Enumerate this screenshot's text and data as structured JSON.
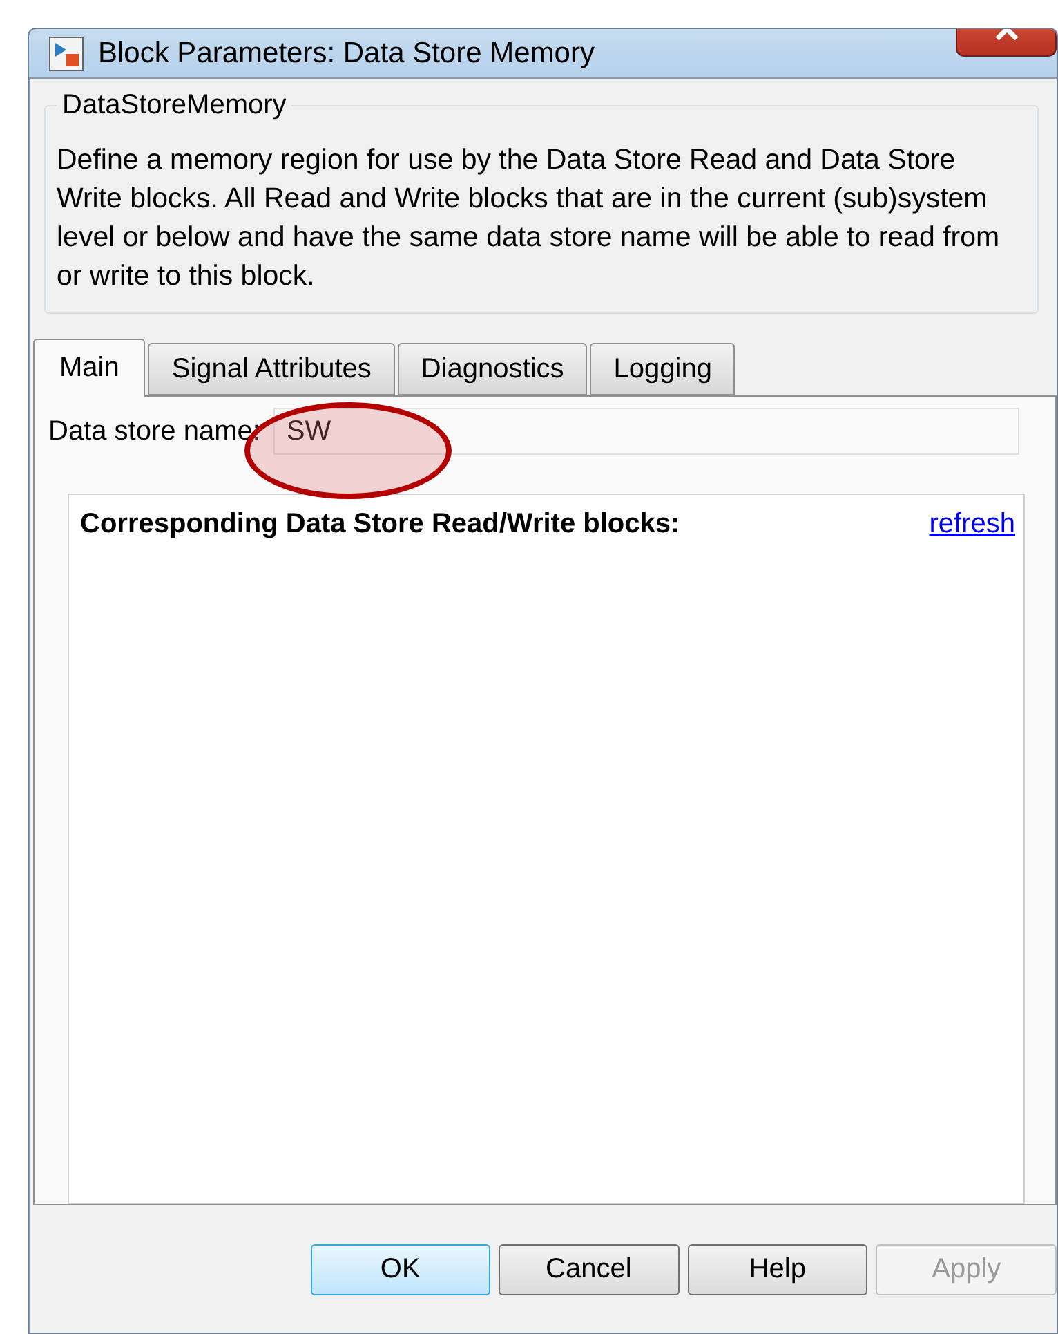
{
  "window": {
    "title": "Block Parameters: Data Store Memory"
  },
  "group": {
    "title": "DataStoreMemory",
    "description": "Define a memory region for use by the Data Store Read and Data Store Write blocks. All Read and Write blocks that are in the current (sub)system level or below and have the same data store name will be able to read from or write to this block."
  },
  "tabs": [
    {
      "label": "Main",
      "selected": true
    },
    {
      "label": "Signal Attributes",
      "selected": false
    },
    {
      "label": "Diagnostics",
      "selected": false
    },
    {
      "label": "Logging",
      "selected": false
    }
  ],
  "field": {
    "label": "Data store name:",
    "value": "SW"
  },
  "panel": {
    "heading": "Corresponding Data Store Read/Write blocks:",
    "link": "refresh"
  },
  "buttons": [
    {
      "label": "OK",
      "default": true,
      "disabled": false
    },
    {
      "label": "Cancel",
      "default": false,
      "disabled": false
    },
    {
      "label": "Help",
      "default": false,
      "disabled": false
    },
    {
      "label": "Apply",
      "default": false,
      "disabled": true
    }
  ]
}
